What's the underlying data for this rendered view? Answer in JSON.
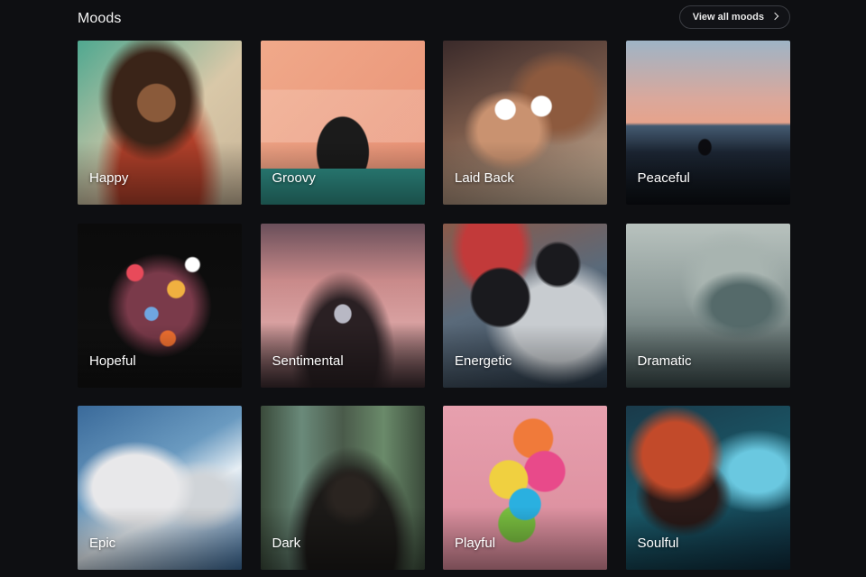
{
  "section": {
    "title": "Moods",
    "view_all_label": "View all moods"
  },
  "moods": [
    {
      "label": "Happy"
    },
    {
      "label": "Groovy"
    },
    {
      "label": "Laid Back"
    },
    {
      "label": "Peaceful"
    },
    {
      "label": "Hopeful"
    },
    {
      "label": "Sentimental"
    },
    {
      "label": "Energetic"
    },
    {
      "label": "Dramatic"
    },
    {
      "label": "Epic"
    },
    {
      "label": "Dark"
    },
    {
      "label": "Playful"
    },
    {
      "label": "Soulful"
    }
  ],
  "colors": {
    "background": "#0e0f12",
    "text": "#ffffff",
    "button_border": "#3a3c42"
  }
}
